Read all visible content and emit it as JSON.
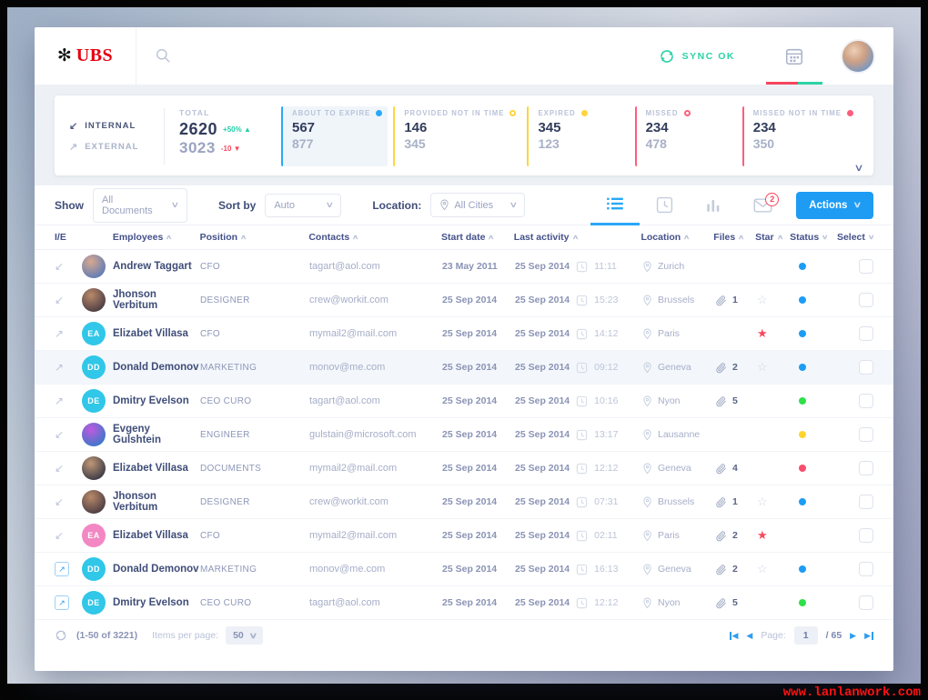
{
  "header": {
    "logo": "UBS",
    "sync": "SYNC OK"
  },
  "stats": {
    "internal": "INTERNAL",
    "external": "EXTERNAL",
    "total": {
      "label": "TOTAL",
      "v1": "2620",
      "d1": "+50%",
      "v2": "3023",
      "d2": "-10"
    },
    "groups": [
      {
        "label": "ABOUT TO EXPIRE",
        "v1": "567",
        "v2": "877",
        "color": "#29a8f7",
        "dot": "filled",
        "highlight": true
      },
      {
        "label": "PROVIDED NOT IN TIME",
        "v1": "146",
        "v2": "345",
        "color": "#ffd43d",
        "dot": "outline"
      },
      {
        "label": "EXPIRED",
        "v1": "345",
        "v2": "123",
        "color": "#ffd43d",
        "dot": "filled"
      },
      {
        "label": "MISSED",
        "v1": "234",
        "v2": "478",
        "color": "#ff5d7d",
        "dot": "outline"
      },
      {
        "label": "MISSED NOT IN TIME",
        "v1": "234",
        "v2": "350",
        "color": "#ff5d7d",
        "dot": "filled"
      }
    ]
  },
  "filters": {
    "show_label": "Show",
    "show_value": "All Documents",
    "sort_label": "Sort by",
    "sort_value": "Auto",
    "location_label": "Location:",
    "location_value": "All Cities",
    "mail_badge": "2",
    "actions_label": "Actions"
  },
  "table": {
    "headers": [
      "I/E",
      "Employees",
      "Position",
      "Contacts",
      "Start date",
      "Last activity",
      "Location",
      "Files",
      "Star",
      "Status",
      "Select"
    ],
    "rows": [
      {
        "dir": "in",
        "avatar": {
          "c1": "#d8a88e",
          "c2": "#5e7bb8"
        },
        "name": "Andrew Taggart",
        "position": "CFO",
        "contact": "tagart@aol.com",
        "start": "23 May 2011",
        "last_date": "25 Sep 2014",
        "last_time": "11:11",
        "location": "Zurich",
        "files": "",
        "star": "none",
        "status": "#1e9cf4"
      },
      {
        "dir": "in",
        "avatar": {
          "c1": "#b98a6a",
          "c2": "#4a3b42"
        },
        "name": "Jhonson Verbitum",
        "position": "DESIGNER",
        "contact": "crew@workit.com",
        "start": "25 Sep 2014",
        "last_date": "25 Sep 2014",
        "last_time": "15:23",
        "location": "Brussels",
        "files": "1",
        "star": "empty",
        "status": "#1e9cf4"
      },
      {
        "dir": "out",
        "avatar": {
          "text": "EA",
          "bg": "#30c7e8"
        },
        "name": "Elizabet Villasa",
        "position": "CFO",
        "contact": "mymail2@mail.com",
        "start": "25 Sep 2014",
        "last_date": "25 Sep 2014",
        "last_time": "14:12",
        "location": "Paris",
        "files": "",
        "star": "filled",
        "status": "#1e9cf4"
      },
      {
        "dir": "out",
        "avatar": {
          "text": "DD",
          "bg": "#30c7e8"
        },
        "name": "Donald Demonov",
        "position": "MARKETING",
        "contact": "monov@me.com",
        "start": "25 Sep 2014",
        "last_date": "25 Sep 2014",
        "last_time": "09:12",
        "location": "Geneva",
        "files": "2",
        "star": "empty",
        "status": "#1e9cf4",
        "highlight": true
      },
      {
        "dir": "out",
        "avatar": {
          "text": "DE",
          "bg": "#30c7e8"
        },
        "name": "Dmitry Evelson",
        "position": "CEO CURO",
        "contact": "tagart@aol.com",
        "start": "25 Sep 2014",
        "last_date": "25 Sep 2014",
        "last_time": "10:16",
        "location": "Nyon",
        "files": "5",
        "star": "none",
        "status": "#2fe049"
      },
      {
        "dir": "in",
        "avatar": {
          "c1": "#c05ae0",
          "c2": "#3878c8"
        },
        "name": "Evgeny Gulshtein",
        "position": "ENGINEER",
        "contact": "gulstain@microsoft.com",
        "start": "25 Sep 2014",
        "last_date": "25 Sep 2014",
        "last_time": "13:17",
        "location": "Lausanne",
        "files": "",
        "star": "none",
        "status": "#ffd42e"
      },
      {
        "dir": "in",
        "avatar": {
          "c1": "#c09878",
          "c2": "#383844"
        },
        "name": "Elizabet Villasa",
        "position": "DOCUMENTS",
        "contact": "mymail2@mail.com",
        "start": "25 Sep 2014",
        "last_date": "25 Sep 2014",
        "last_time": "12:12",
        "location": "Geneva",
        "files": "4",
        "star": "none",
        "status": "#fb4d6d"
      },
      {
        "dir": "in",
        "avatar": {
          "c1": "#b98a6a",
          "c2": "#4a3b42"
        },
        "name": "Jhonson Verbitum",
        "position": "DESIGNER",
        "contact": "crew@workit.com",
        "start": "25 Sep 2014",
        "last_date": "25 Sep 2014",
        "last_time": "07:31",
        "location": "Brussels",
        "files": "1",
        "star": "empty",
        "status": "#1e9cf4"
      },
      {
        "dir": "in",
        "avatar": {
          "text": "EA",
          "bg": "#f287c3"
        },
        "name": "Elizabet Villasa",
        "position": "CFO",
        "contact": "mymail2@mail.com",
        "start": "25 Sep 2014",
        "last_date": "25 Sep 2014",
        "last_time": "02:11",
        "location": "Paris",
        "files": "2",
        "star": "filled",
        "status": ""
      },
      {
        "dir": "open",
        "avatar": {
          "text": "DD",
          "bg": "#30c7e8"
        },
        "name": "Donald Demonov",
        "position": "MARKETING",
        "contact": "monov@me.com",
        "start": "25 Sep 2014",
        "last_date": "25 Sep 2014",
        "last_time": "16:13",
        "location": "Geneva",
        "files": "2",
        "star": "empty",
        "status": "#1e9cf4"
      },
      {
        "dir": "open",
        "avatar": {
          "text": "DE",
          "bg": "#30c7e8"
        },
        "name": "Dmitry Evelson",
        "position": "CEO CURO",
        "contact": "tagart@aol.com",
        "start": "25 Sep 2014",
        "last_date": "25 Sep 2014",
        "last_time": "12:12",
        "location": "Nyon",
        "files": "5",
        "star": "none",
        "status": "#2fe049"
      }
    ]
  },
  "footer": {
    "range": "(1-50 of 3221)",
    "items_per_page_label": "Items per page:",
    "items_per_page": "50",
    "page_label": "Page:",
    "page": "1",
    "total_pages": "/ 65"
  },
  "watermark": "www.lanlanwork.com"
}
